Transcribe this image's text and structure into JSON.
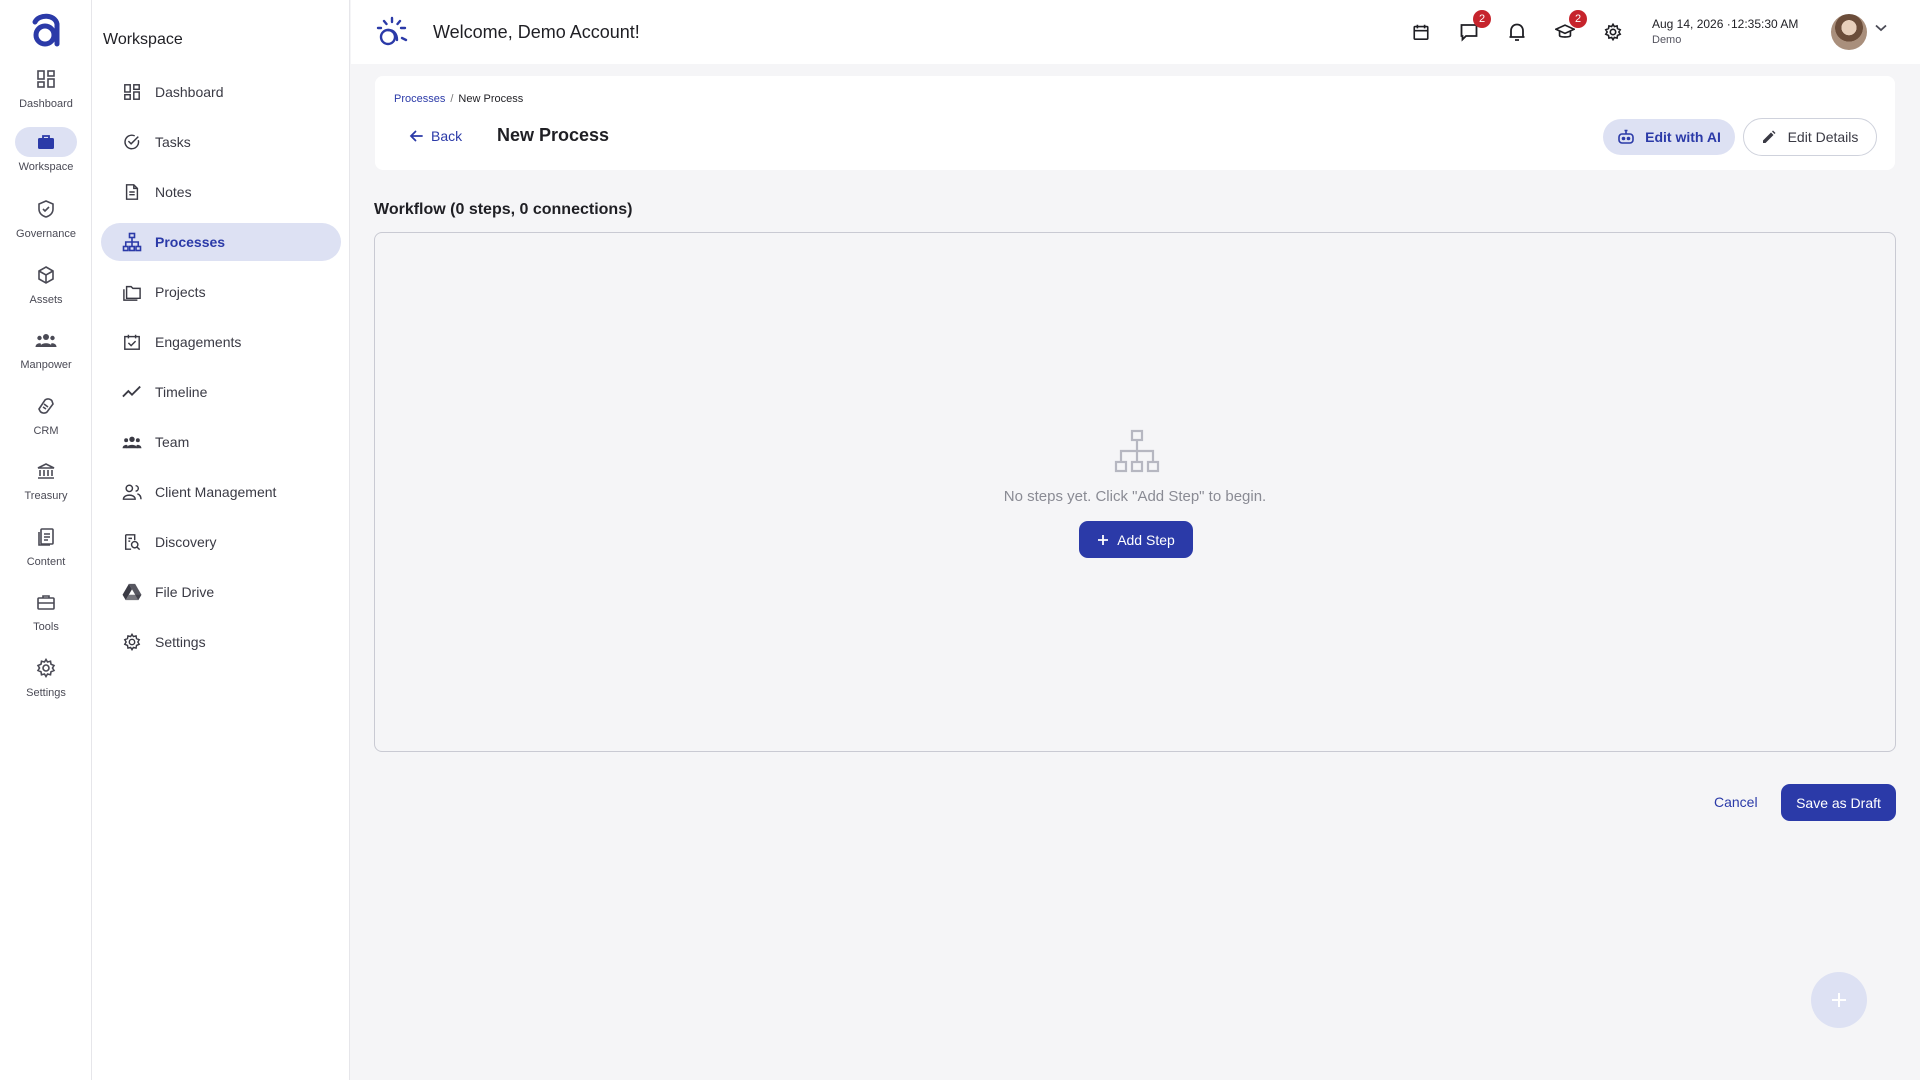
{
  "rail": {
    "items": [
      {
        "label": "Dashboard",
        "icon": "dashboard-icon"
      },
      {
        "label": "Workspace",
        "icon": "briefcase-icon",
        "active": true
      },
      {
        "label": "Governance",
        "icon": "shield-check-icon"
      },
      {
        "label": "Assets",
        "icon": "cube-icon"
      },
      {
        "label": "Manpower",
        "icon": "people-icon"
      },
      {
        "label": "CRM",
        "icon": "handshake-icon"
      },
      {
        "label": "Treasury",
        "icon": "bank-icon"
      },
      {
        "label": "Content",
        "icon": "document-icon"
      },
      {
        "label": "Tools",
        "icon": "toolbox-icon"
      },
      {
        "label": "Settings",
        "icon": "gear-icon"
      }
    ]
  },
  "sidebar": {
    "title": "Workspace",
    "items": [
      {
        "label": "Dashboard",
        "icon": "dashboard-icon"
      },
      {
        "label": "Tasks",
        "icon": "check-circle-icon"
      },
      {
        "label": "Notes",
        "icon": "note-icon"
      },
      {
        "label": "Processes",
        "icon": "hierarchy-icon",
        "active": true
      },
      {
        "label": "Projects",
        "icon": "folders-icon"
      },
      {
        "label": "Engagements",
        "icon": "calendar-check-icon"
      },
      {
        "label": "Timeline",
        "icon": "trend-line-icon"
      },
      {
        "label": "Team",
        "icon": "people-icon"
      },
      {
        "label": "Client Management",
        "icon": "client-icon"
      },
      {
        "label": "Discovery",
        "icon": "search-document-icon"
      },
      {
        "label": "File Drive",
        "icon": "drive-icon"
      },
      {
        "label": "Settings",
        "icon": "gear-icon"
      }
    ]
  },
  "header": {
    "welcome": "Welcome, Demo Account!",
    "chat_badge": "2",
    "learning_badge": "2",
    "date": "Aug 14, 2026 ·",
    "time": "12:35:30 AM",
    "user": "Demo"
  },
  "breadcrumb": {
    "parent": "Processes",
    "separator": "/",
    "current": "New Process"
  },
  "page": {
    "back_label": "Back",
    "title": "New Process",
    "edit_ai_label": "Edit with AI",
    "edit_details_label": "Edit Details"
  },
  "workflow": {
    "title": "Workflow (0 steps, 0 connections)",
    "empty_text": "No steps yet. Click \"Add Step\" to begin.",
    "add_step_label": "Add Step"
  },
  "actions": {
    "cancel_label": "Cancel",
    "save_draft_label": "Save as Draft"
  },
  "colors": {
    "accent": "#2b3aa8",
    "accent_soft": "#dde1f3",
    "badge": "#c6242c",
    "background": "#f5f5f7"
  }
}
